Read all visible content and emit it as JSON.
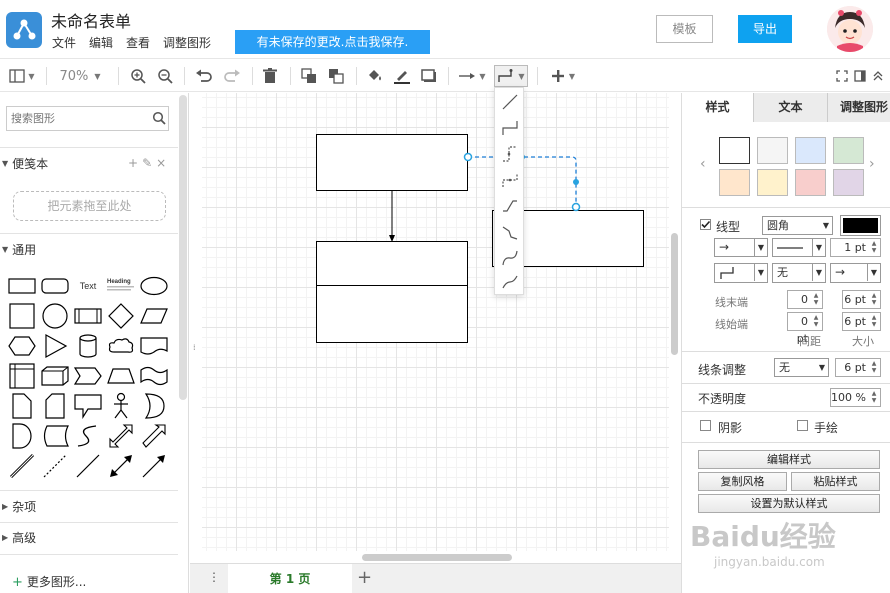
{
  "app": {
    "title": "未命名表单",
    "menus": [
      "文件",
      "编辑",
      "查看",
      "调整图形"
    ],
    "unsaved_notice": "有未保存的更改.点击我保存.",
    "template_button": "模板",
    "export_button": "导出",
    "brand_color": "#0ea2f0"
  },
  "toolbar": {
    "zoom": "70%",
    "icons": [
      "panel-icon",
      "zoom-in-icon",
      "zoom-out-icon",
      "undo-icon",
      "redo-icon",
      "delete-icon",
      "to-front-icon",
      "to-back-icon",
      "fill-color-icon",
      "line-color-icon",
      "shadow-icon",
      "connection-arrow-icon",
      "waypoint-icon",
      "insert-icon",
      "fullscreen-icon",
      "format-panel-icon",
      "collapse-icon"
    ]
  },
  "left": {
    "search_placeholder": "搜索图形",
    "scratchpad_label": "便笺本",
    "scratchpad_actions": [
      "+",
      "✎",
      "×"
    ],
    "drop_zone": "把元素拖至此处",
    "general_label": "通用",
    "misc_label": "杂项",
    "advanced_label": "高级",
    "more_shapes": "更多图形...",
    "shape_text_label": "Text",
    "shape_heading_label": "Heading"
  },
  "page": {
    "tab_label": "第 1 页",
    "add": "+"
  },
  "right": {
    "tabs": [
      "样式",
      "文本",
      "调整图形"
    ],
    "swatches": [
      "#ffffff",
      "#f5f5f5",
      "#dae8fc",
      "#d5e8d4",
      "#ffe6cc",
      "#fff2cc",
      "#f8cecc",
      "#e1d5e7"
    ],
    "line_label": "线型",
    "line_checked": true,
    "corner_style": "圆角",
    "line_color": "#000000",
    "line_width": "1 pt",
    "waypoint_none": "无",
    "line_end_label": "线末端",
    "line_start_label": "线始端",
    "end_spacing": "0 pt",
    "end_size": "6 pt",
    "start_spacing": "0 pt",
    "start_size": "6 pt",
    "spacing_label": "间距",
    "size_label": "大小",
    "jump_label": "线条调整",
    "jump_style": "无",
    "jump_size": "6 pt",
    "opacity_label": "不透明度",
    "opacity": "100 %",
    "shadow_label": "阴影",
    "sketch_label": "手绘",
    "edit_style": "编辑样式",
    "copy_style": "复制风格",
    "paste_style": "粘贴样式",
    "set_default": "设置为默认样式"
  },
  "watermark": {
    "text": "Baidu经验",
    "sub": "jingyan.baidu.com"
  }
}
